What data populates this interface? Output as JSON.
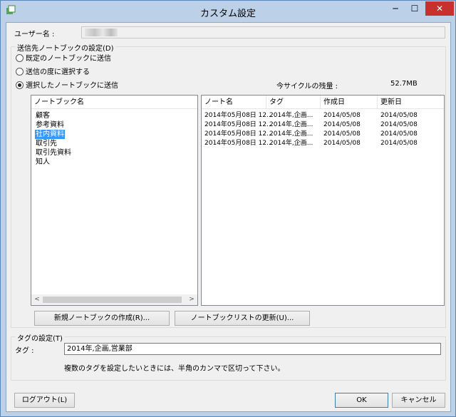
{
  "window": {
    "title": "カスタム設定",
    "minimize_glyph": "─",
    "maximize_glyph": "☐",
    "close_glyph": "✕",
    "accent": "#bcd0e8",
    "close_color": "#c7302d"
  },
  "user": {
    "label": "ユーザー名 :"
  },
  "destination": {
    "group_title": "送信先ノートブックの設定(D)",
    "options": [
      {
        "label": "既定のノートブックに送信",
        "selected": false
      },
      {
        "label": "送信の度に選択する",
        "selected": false
      },
      {
        "label": "選択したノートブックに送信",
        "selected": true
      }
    ],
    "quota_label": "今サイクルの残量 :",
    "quota_value": "52.7MB"
  },
  "notebooks": {
    "header": "ノートブック名",
    "items": [
      "顧客",
      "参考資料",
      "社内資料",
      "取引先",
      "取引先資料",
      "知人"
    ],
    "selected_index": 2,
    "scroll_left_glyph": "<",
    "scroll_right_glyph": ">"
  },
  "notes": {
    "headers": [
      "ノート名",
      "タグ",
      "作成日",
      "更新日"
    ],
    "rows": [
      [
        "2014年05月08日 12...",
        "2014年,企画...",
        "2014/05/08",
        "2014/05/08"
      ],
      [
        "2014年05月08日 12...",
        "2014年,企画...",
        "2014/05/08",
        "2014/05/08"
      ],
      [
        "2014年05月08日 12...",
        "2014年,企画...",
        "2014/05/08",
        "2014/05/08"
      ],
      [
        "2014年05月08日 12...",
        "2014年,企画...",
        "2014/05/08",
        "2014/05/08"
      ]
    ]
  },
  "buttons": {
    "new_notebook": "新規ノートブックの作成(R)...",
    "refresh_list": "ノートブックリストの更新(U)...",
    "logout": "ログアウト(L)",
    "ok": "OK",
    "cancel": "キャンセル"
  },
  "tags": {
    "group_title": "タグの設定(T)",
    "label": "タグ :",
    "value": "2014年,企画,営業部",
    "hint": "複数のタグを設定したいときには、半角のカンマで区切って下さい。"
  },
  "icons": {
    "app": "evernote-clip-icon"
  }
}
